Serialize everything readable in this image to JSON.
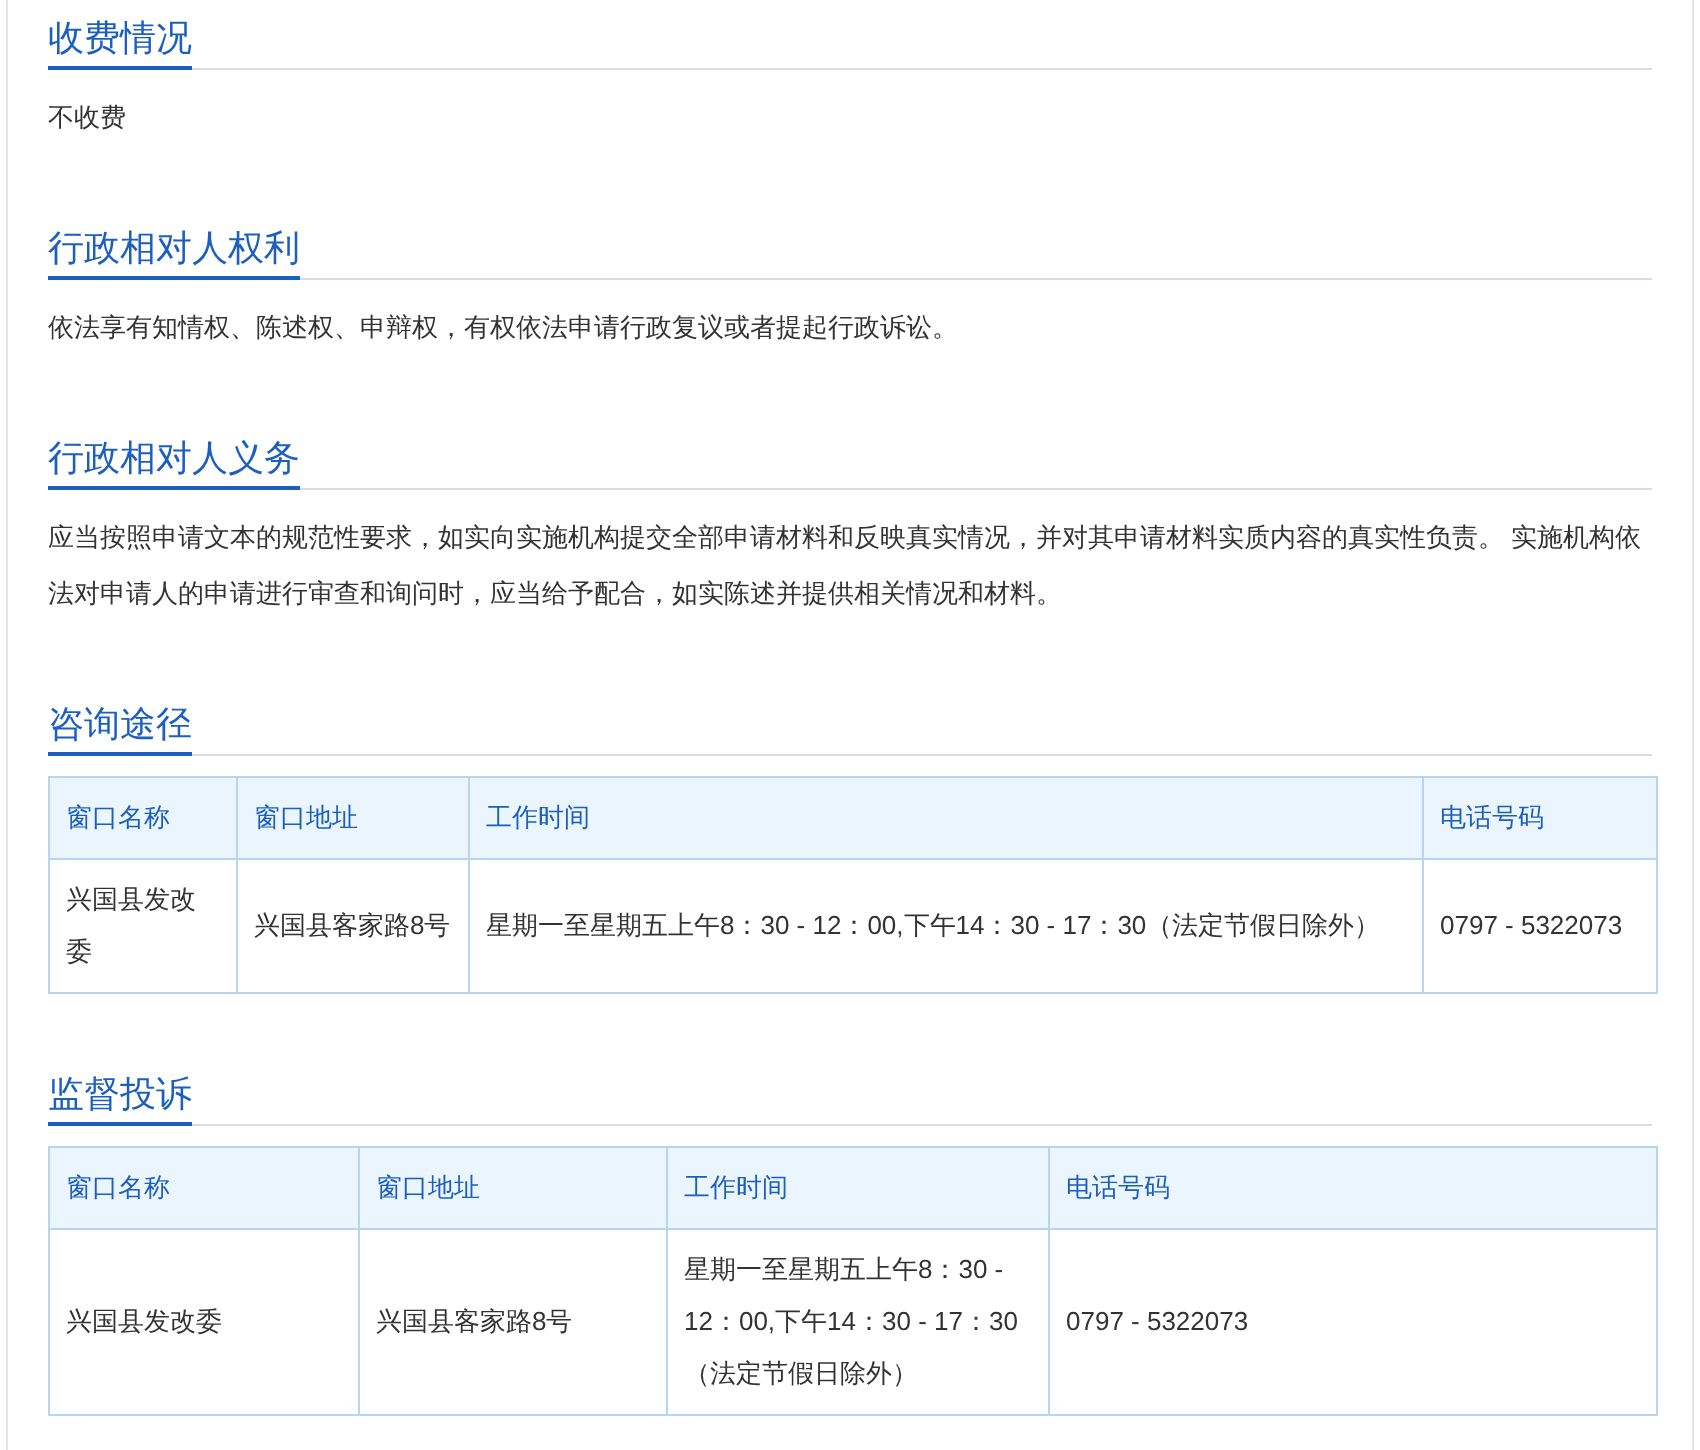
{
  "sections": [
    {
      "kind": "text",
      "title": "收费情况",
      "text": "不收费"
    },
    {
      "kind": "text",
      "title": "行政相对人权利",
      "text": "依法享有知情权、陈述权、申辩权，有权依法申请行政复议或者提起行政诉讼。"
    },
    {
      "kind": "text",
      "title": "行政相对人义务",
      "text": "应当按照申请文本的规范性要求，如实向实施机构提交全部申请材料和反映真实情况，并对其申请材料实质内容的真实性负责。 实施机构依法对申请人的申请进行审查和询问时，应当给予配合，如实陈述并提供相关情况和材料。"
    },
    {
      "kind": "table",
      "title": "咨询途径",
      "columns": [
        "窗口名称",
        "窗口地址",
        "工作时间",
        "电话号码"
      ],
      "rows": [
        [
          "兴国县发改委",
          "兴国县客家路8号",
          "星期一至星期五上午8：30 - 12：00,下午14：30 - 17：30（法定节假日除外）",
          "0797 - 5322073"
        ]
      ]
    },
    {
      "kind": "table",
      "title": "监督投诉",
      "columns": [
        "窗口名称",
        "窗口地址",
        "工作时间",
        "电话号码"
      ],
      "rows": [
        [
          "兴国县发改委",
          "兴国县客家路8号",
          "星期一至星期五上午8：30 - 12：00,下午14：30 - 17：30（法定节假日除外）",
          "0797 - 5322073"
        ]
      ]
    }
  ]
}
